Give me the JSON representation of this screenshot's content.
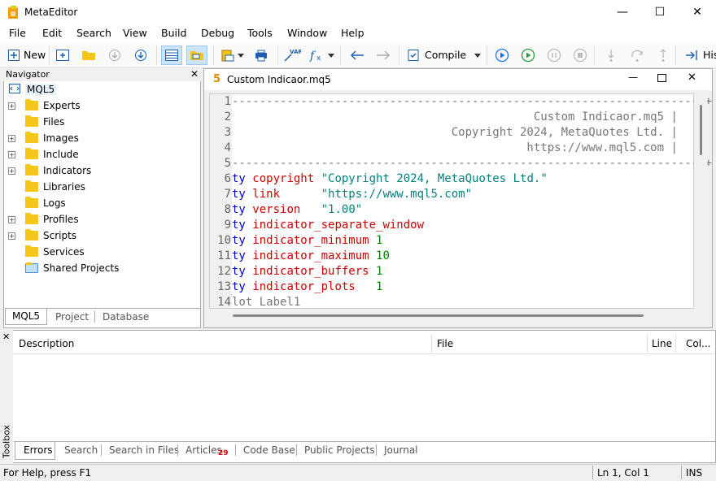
{
  "window": {
    "title": "MetaEditor"
  },
  "menu": [
    "File",
    "Edit",
    "Search",
    "View",
    "Build",
    "Debug",
    "Tools",
    "Window",
    "Help"
  ],
  "toolbar": {
    "new_label": "New",
    "compile_label": "Compile",
    "history_label": "His"
  },
  "navigator": {
    "title": "Navigator",
    "root": "MQL5",
    "items": [
      {
        "label": "Experts",
        "expandable": true
      },
      {
        "label": "Files",
        "expandable": false
      },
      {
        "label": "Images",
        "expandable": true
      },
      {
        "label": "Include",
        "expandable": true
      },
      {
        "label": "Indicators",
        "expandable": true
      },
      {
        "label": "Libraries",
        "expandable": false
      },
      {
        "label": "Logs",
        "expandable": false
      },
      {
        "label": "Profiles",
        "expandable": true
      },
      {
        "label": "Scripts",
        "expandable": true
      },
      {
        "label": "Services",
        "expandable": false
      },
      {
        "label": "Shared Projects",
        "expandable": false
      }
    ],
    "tabs": [
      "MQL5",
      "Project",
      "Database"
    ]
  },
  "editor": {
    "tab_number": "5",
    "tab_title": "Custom Indicaor.mq5",
    "lines": [
      {
        "n": "1",
        "text": "---------------------------------------------------------------------+",
        "cls": "cmt"
      },
      {
        "n": "2",
        "text": "                                            Custom Indicaor.mq5 |",
        "cls": "cmt"
      },
      {
        "n": "3",
        "text": "                                Copyright 2024, MetaQuotes Ltd. |",
        "cls": "cmt"
      },
      {
        "n": "4",
        "text": "                                           https://www.mql5.com |",
        "cls": "cmt"
      },
      {
        "n": "5",
        "text": "---------------------------------------------------------------------+",
        "cls": "cmt"
      },
      {
        "n": "6",
        "kw": "ty",
        "prop": "copyright",
        "pad": " ",
        "val": "\"Copyright 2024, MetaQuotes Ltd.\"",
        "vcls": "str"
      },
      {
        "n": "7",
        "kw": "ty",
        "prop": "link",
        "pad": "      ",
        "val": "\"https://www.mql5.com\"",
        "vcls": "str"
      },
      {
        "n": "8",
        "kw": "ty",
        "prop": "version",
        "pad": "   ",
        "val": "\"1.00\"",
        "vcls": "str"
      },
      {
        "n": "9",
        "kw": "ty",
        "prop": "indicator_separate_window",
        "pad": "",
        "val": "",
        "vcls": "num"
      },
      {
        "n": "10",
        "kw": "ty",
        "prop": "indicator_minimum",
        "pad": " ",
        "val": "1",
        "vcls": "num"
      },
      {
        "n": "11",
        "kw": "ty",
        "prop": "indicator_maximum",
        "pad": " ",
        "val": "10",
        "vcls": "num"
      },
      {
        "n": "12",
        "kw": "ty",
        "prop": "indicator_buffers",
        "pad": " ",
        "val": "1",
        "vcls": "num"
      },
      {
        "n": "13",
        "kw": "ty",
        "prop": "indicator_plots",
        "pad": "   ",
        "val": "1",
        "vcls": "num"
      },
      {
        "n": "14",
        "text": "lot Label1",
        "cls": "cmt"
      }
    ]
  },
  "toolbox": {
    "side_label": "Toolbox",
    "columns": [
      "Description",
      "File",
      "Line",
      "Col..."
    ],
    "tabs": [
      "Errors",
      "Search",
      "Search in Files",
      "Articles",
      "Code Base",
      "Public Projects",
      "Journal"
    ],
    "articles_badge": "29"
  },
  "status": {
    "help": "For Help, press F1",
    "position": "Ln 1, Col 1",
    "mode": "INS"
  }
}
